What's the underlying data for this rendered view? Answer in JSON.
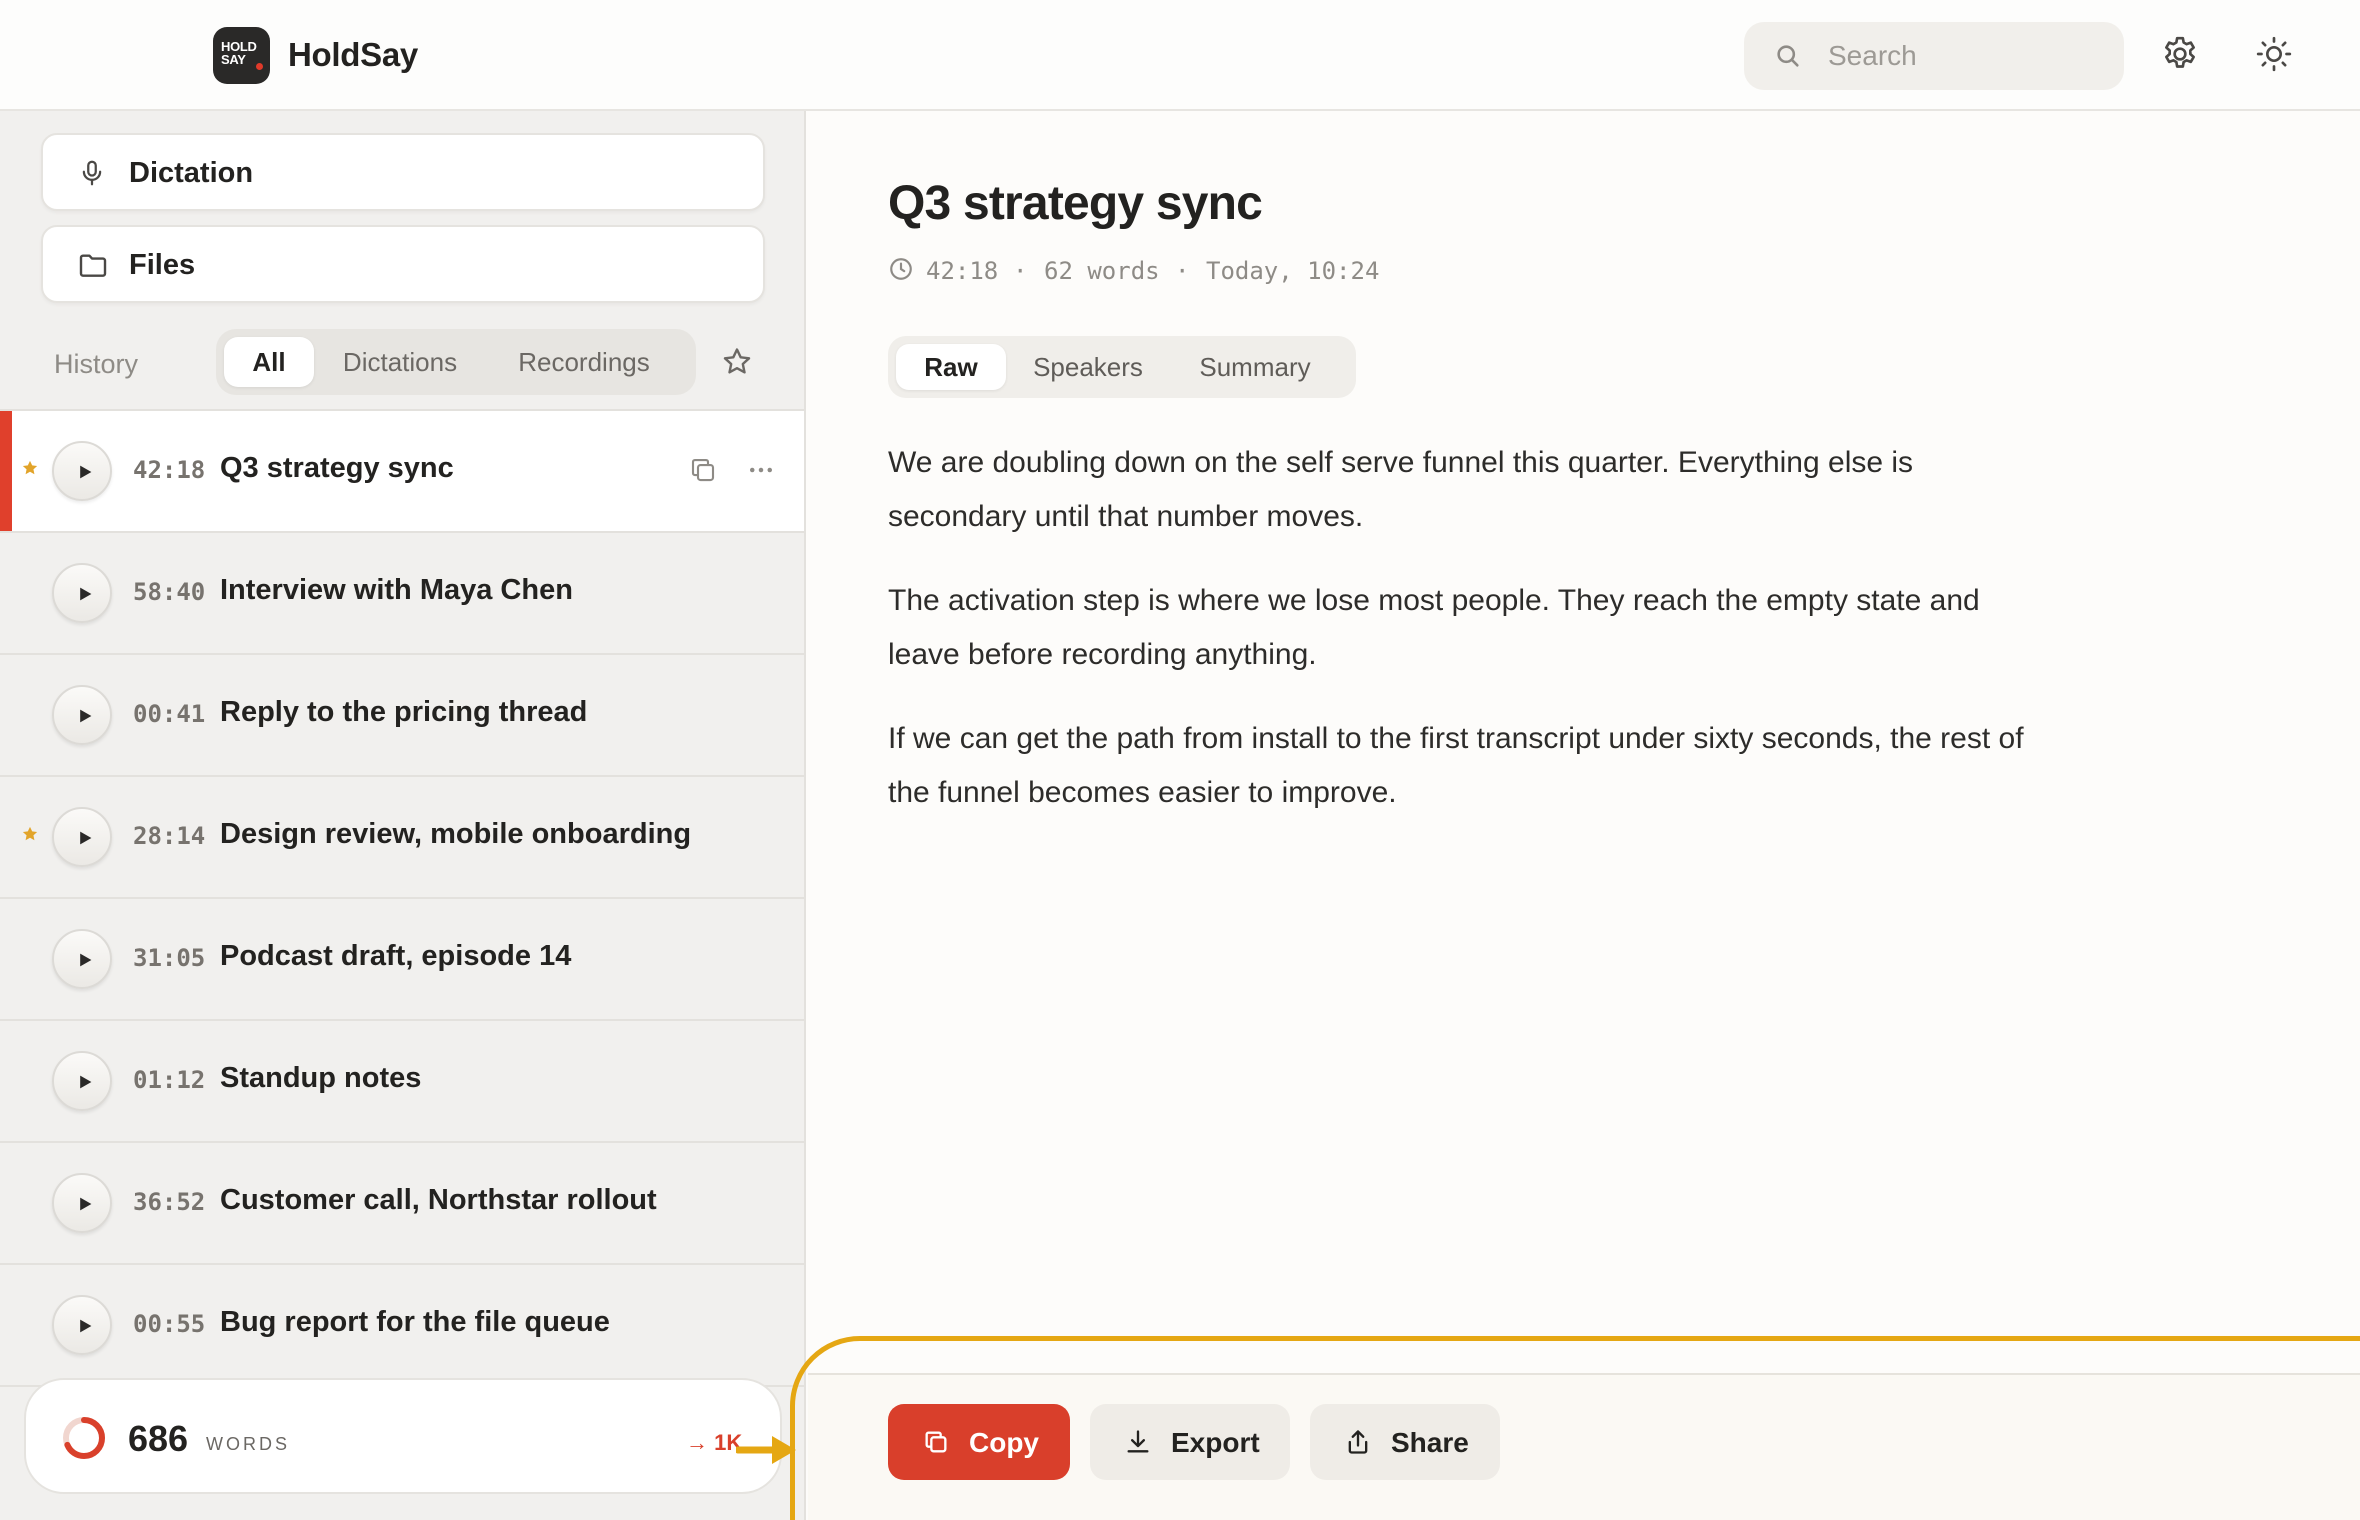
{
  "app": {
    "logo_text_top": "HOLD",
    "logo_text_bottom": "SAY",
    "name": "HoldSay",
    "brand_color": "#d93f2b",
    "highlight_color": "#e5a713"
  },
  "header": {
    "search": {
      "placeholder": "Search",
      "icon": "search-icon"
    },
    "settings_icon": "gear-icon",
    "theme_icon": "sun-icon"
  },
  "sidebar": {
    "nav": [
      {
        "label": "Dictation",
        "icon": "microphone-icon"
      },
      {
        "label": "Files",
        "icon": "folder-icon"
      }
    ],
    "history_label": "History",
    "filters": [
      "All",
      "Dictations",
      "Recordings"
    ],
    "active_filter": "All",
    "items": [
      {
        "duration": "42:18",
        "title": "Q3 strategy sync",
        "starred": true,
        "active": true
      },
      {
        "duration": "58:40",
        "title": "Interview with Maya Chen",
        "starred": false,
        "active": false
      },
      {
        "duration": "00:41",
        "title": "Reply to the pricing thread",
        "starred": false,
        "active": false
      },
      {
        "duration": "28:14",
        "title": "Design review, mobile onboarding",
        "starred": true,
        "active": false
      },
      {
        "duration": "31:05",
        "title": "Podcast draft, episode 14",
        "starred": false,
        "active": false
      },
      {
        "duration": "01:12",
        "title": "Standup notes",
        "starred": false,
        "active": false
      },
      {
        "duration": "36:52",
        "title": "Customer call, Northstar rollout",
        "starred": false,
        "active": false
      },
      {
        "duration": "00:55",
        "title": "Bug report for the file queue",
        "starred": false,
        "active": false
      }
    ],
    "word_count": {
      "value": "686",
      "unit": "WORDS",
      "goal": "→ 1K",
      "progress": 0.686
    }
  },
  "document": {
    "title": "Q3 strategy sync",
    "meta": {
      "duration": "42:18",
      "words": "62 words",
      "date": "Today, 10:24",
      "separator": "·"
    },
    "tabs": [
      "Raw",
      "Speakers",
      "Summary"
    ],
    "active_tab": "Raw",
    "paragraphs": [
      "We are doubling down on the self serve funnel this quarter. Everything else is secondary until that number moves.",
      "The activation step is where we lose most people. They reach the empty state and leave before recording anything.",
      "If we can get the path from install to the first transcript under sixty seconds, the rest of the funnel becomes easier to improve."
    ]
  },
  "actions": {
    "copy": "Copy",
    "export": "Export",
    "share": "Share"
  }
}
